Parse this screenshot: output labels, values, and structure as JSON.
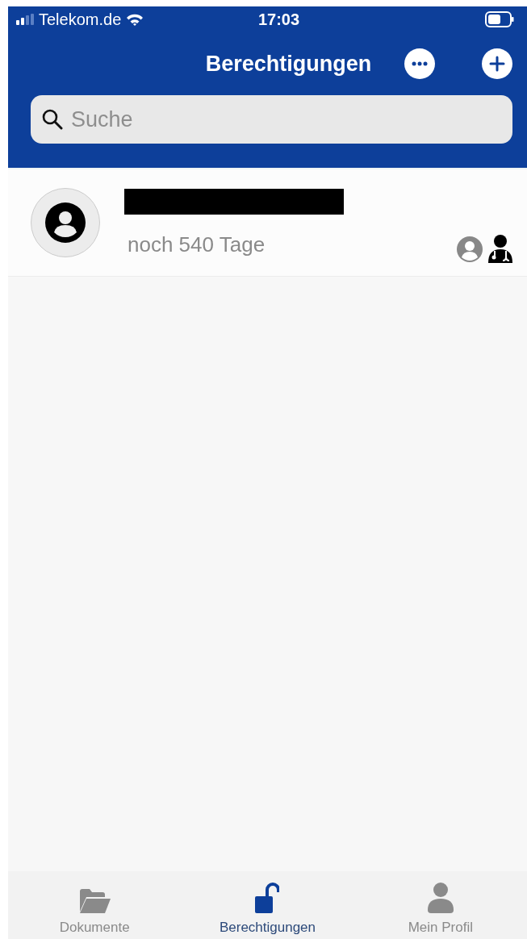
{
  "status_bar": {
    "carrier": "Telekom.de",
    "time": "17:03"
  },
  "header": {
    "title": "Berechtigungen",
    "buttons": [
      {
        "kind": "more"
      },
      {
        "kind": "add"
      }
    ]
  },
  "search": {
    "placeholder": "Suche"
  },
  "list": [
    {
      "redacted": true,
      "remaining": "noch 540 Tage",
      "roles": [
        {
          "kind": "person"
        },
        {
          "kind": "doctor"
        }
      ]
    }
  ],
  "tabs": [
    {
      "label": "Dokumente",
      "kind": "folder",
      "selected": false
    },
    {
      "label": "Berechtigungen",
      "kind": "lock",
      "selected": true
    },
    {
      "label": "Mein Profil",
      "kind": "person",
      "selected": false
    }
  ]
}
